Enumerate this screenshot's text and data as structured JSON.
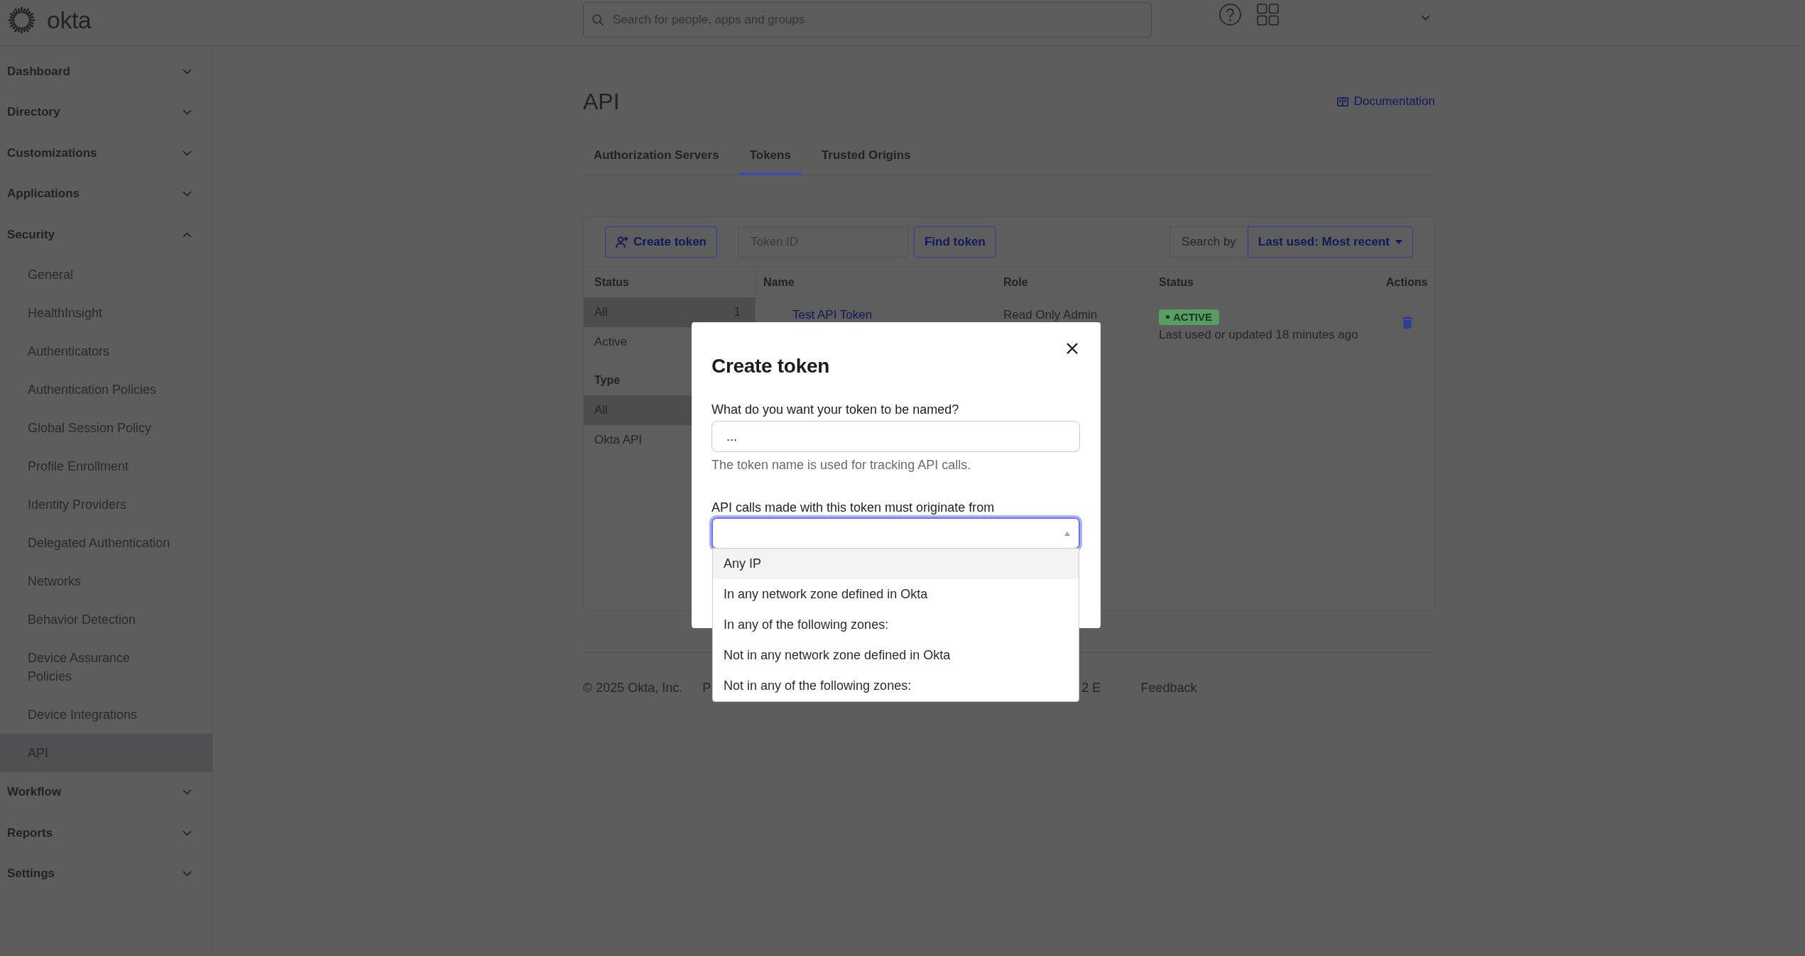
{
  "topbar": {
    "logo": "okta",
    "search": {
      "placeholder": "Search for people, apps and groups"
    }
  },
  "sidebar": {
    "items": [
      {
        "label": "Dashboard",
        "expanded": false
      },
      {
        "label": "Directory",
        "expanded": false
      },
      {
        "label": "Customizations",
        "expanded": false
      },
      {
        "label": "Applications",
        "expanded": false
      },
      {
        "label": "Security",
        "expanded": true,
        "children": [
          {
            "label": "General",
            "selected": false
          },
          {
            "label": "HealthInsight",
            "selected": false
          },
          {
            "label": "Authenticators",
            "selected": false
          },
          {
            "label": "Authentication Policies",
            "selected": false
          },
          {
            "label": "Global Session Policy",
            "selected": false
          },
          {
            "label": "Profile Enrollment",
            "selected": false
          },
          {
            "label": "Identity Providers",
            "selected": false
          },
          {
            "label": "Delegated Authentication",
            "selected": false
          },
          {
            "label": "Networks",
            "selected": false
          },
          {
            "label": "Behavior Detection",
            "selected": false
          },
          {
            "label": "Device Assurance Policies",
            "selected": false
          },
          {
            "label": "Device Integrations",
            "selected": false
          },
          {
            "label": "API",
            "selected": true
          }
        ]
      },
      {
        "label": "Workflow",
        "expanded": false
      },
      {
        "label": "Reports",
        "expanded": false
      },
      {
        "label": "Settings",
        "expanded": false
      }
    ]
  },
  "page": {
    "title": "API",
    "documentation_link": "Documentation",
    "tabs": [
      {
        "label": "Authorization Servers",
        "selected": false
      },
      {
        "label": "Tokens",
        "selected": true
      },
      {
        "label": "Trusted Origins",
        "selected": false
      }
    ]
  },
  "toolbar": {
    "create_button": "Create token",
    "token_search": {
      "placeholder": "Token ID"
    },
    "find_button": "Find token",
    "search_by_label": "Search by",
    "sort_button": "Last used: Most recent"
  },
  "filters": [
    {
      "title": "Status",
      "options": [
        {
          "label": "All",
          "count": "1",
          "selected": true
        },
        {
          "label": "Active",
          "selected": false
        }
      ]
    },
    {
      "title": "Type",
      "options": [
        {
          "label": "All",
          "selected": true
        },
        {
          "label": "Okta API",
          "selected": false
        }
      ]
    }
  ],
  "table": {
    "columns": [
      "Name",
      "Role",
      "Status",
      "Actions"
    ],
    "rows": [
      {
        "name": "Test API Token",
        "role": "Read Only Admin",
        "status": "ACTIVE",
        "last_used": "Last used or updated 18 minutes ago"
      }
    ]
  },
  "footer": {
    "items": [
      "© 2025 Okta, Inc.",
      "P",
      "2 E",
      "Feedback"
    ]
  },
  "modal": {
    "title": "Create token",
    "fields": [
      {
        "kind": "text",
        "label": "What do you want your token to be named?",
        "value": "...",
        "help": "The token name is used for tracking API calls."
      },
      {
        "kind": "select",
        "label": "API calls made with this token must originate from",
        "expanded": true,
        "options": [
          {
            "label": "Any IP",
            "highlighted": true
          },
          {
            "label": "In any network zone defined in Okta",
            "highlighted": false
          },
          {
            "label": "In any of the following zones:",
            "highlighted": false
          },
          {
            "label": "Not in any network zone defined in Okta",
            "highlighted": false
          },
          {
            "label": "Not in any of the following zones:",
            "highlighted": false
          }
        ]
      }
    ]
  }
}
